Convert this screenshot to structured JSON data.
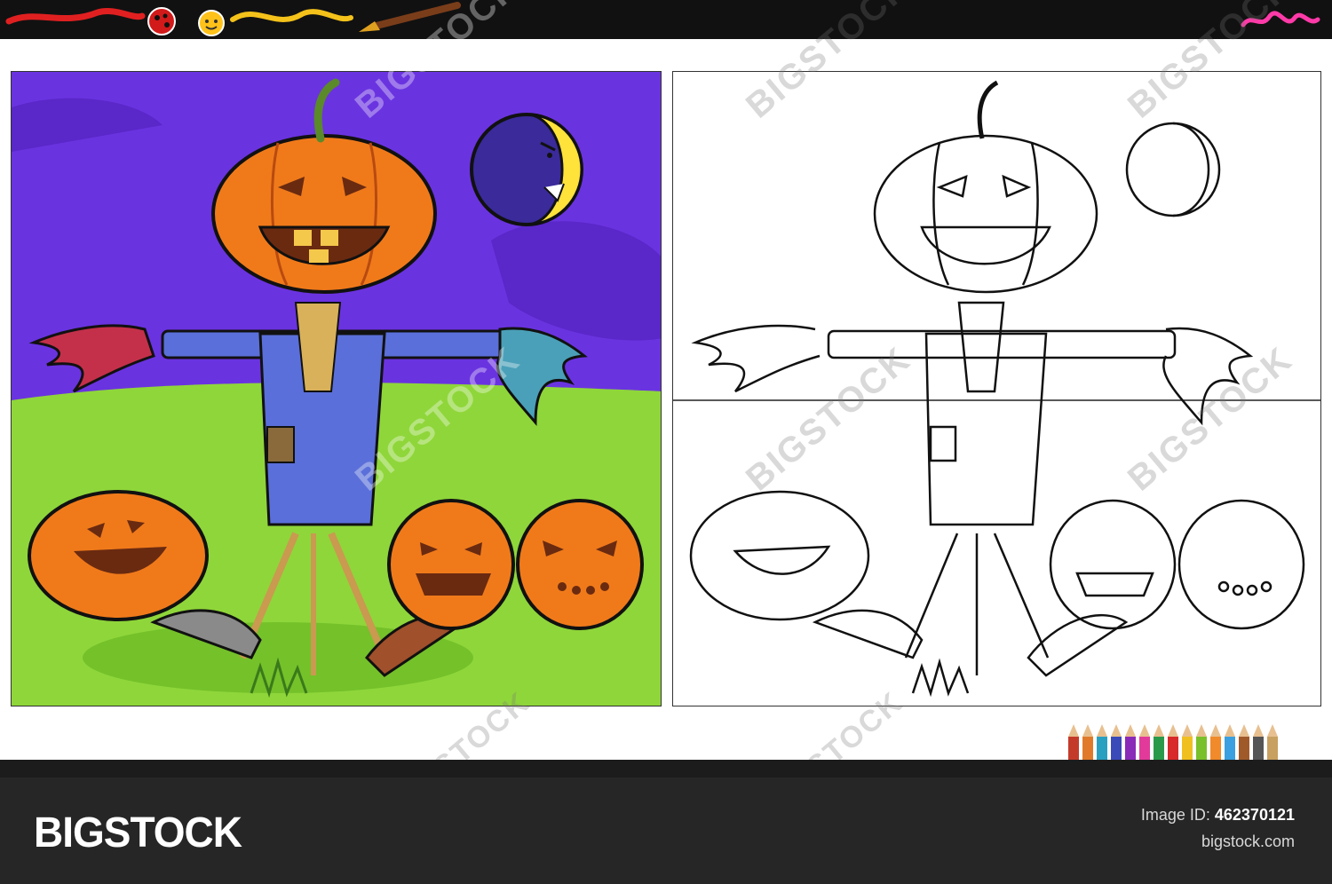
{
  "brand": {
    "name": "BIGSTOCK"
  },
  "image_info": {
    "id_label": "Image ID:",
    "id_value": "462370121",
    "site": "bigstock.com"
  },
  "watermark": {
    "text": "BIGSTOCK",
    "short_text": "BIG"
  },
  "colors": {
    "sky": "#6a33e0",
    "grass": "#8fd63a",
    "pumpkin": "#f07a1a",
    "moon": "#ffe23a",
    "shirt": "#5a6fd9",
    "footer_bg": "#262626"
  },
  "icons": [
    "paintbrush-icon",
    "ladybug-icon",
    "sun-icon",
    "paint-tube-icon",
    "colored-pencils-icon"
  ]
}
